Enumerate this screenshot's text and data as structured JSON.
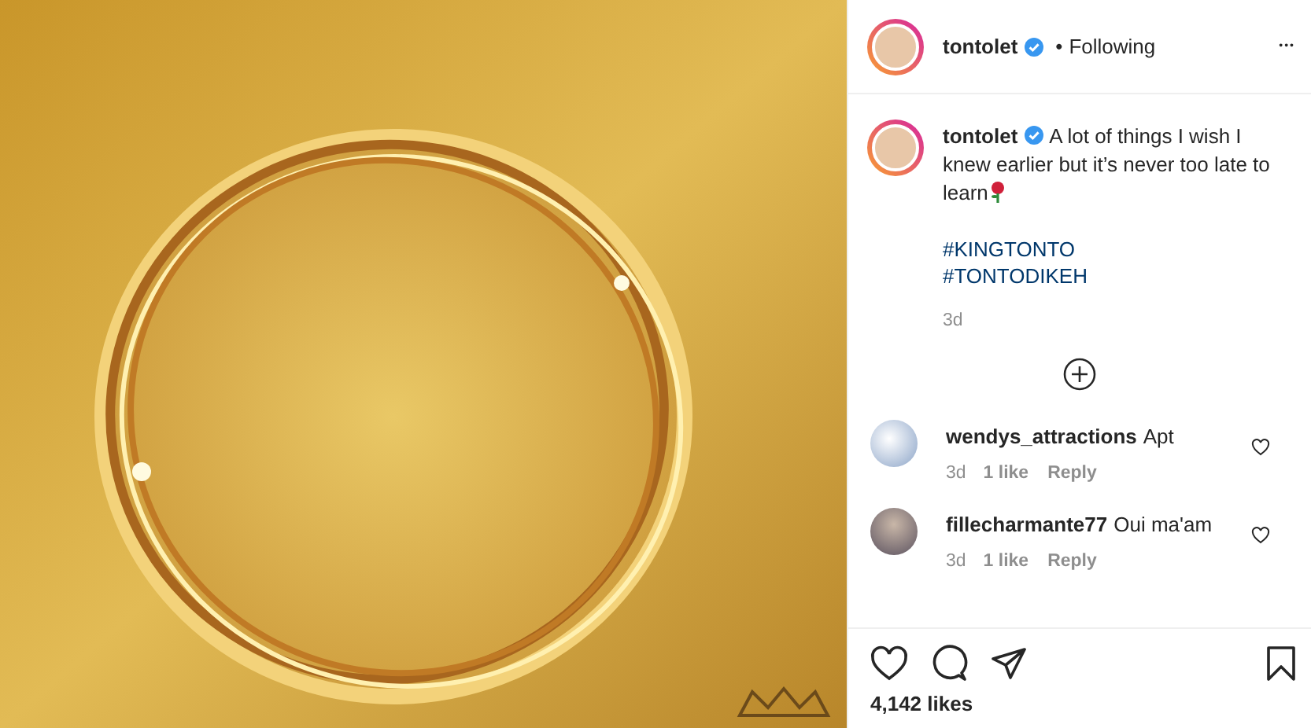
{
  "header": {
    "username": "tontolet",
    "verified": true,
    "separator": "•",
    "follow_status": "Following",
    "more": "•••"
  },
  "caption": {
    "username": "tontolet",
    "verified": true,
    "text": "A lot of things I wish I knew earlier but it’s never too late to learn",
    "hashtags": [
      "#KINGTONTO",
      "#TONTODIKEH"
    ],
    "time": "3d"
  },
  "comments": [
    {
      "username": "wendys_attractions",
      "text": "Apt",
      "time": "3d",
      "likes": "1 like",
      "reply": "Reply",
      "liked": false
    },
    {
      "username": "fillecharmante77",
      "text": "Oui ma'am",
      "time": "3d",
      "likes": "1 like",
      "reply": "Reply",
      "liked": false
    }
  ],
  "actions": {
    "liked": false,
    "saved": false
  },
  "likes": "4,142 likes"
}
